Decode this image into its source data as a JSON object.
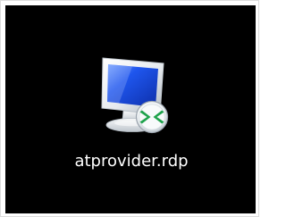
{
  "desktop": {
    "background_color": "#000000",
    "icon": {
      "label": "atprovider.rdp",
      "icon_name": "remote-desktop-connection-file-icon",
      "badge_icon_name": "remote-desktop-arrows-badge-icon",
      "colors": {
        "screen_blue": "#1240d8",
        "bezel": "#e9ecef",
        "badge_green": "#19a14a",
        "badge_ring": "#eef2f4"
      }
    }
  }
}
